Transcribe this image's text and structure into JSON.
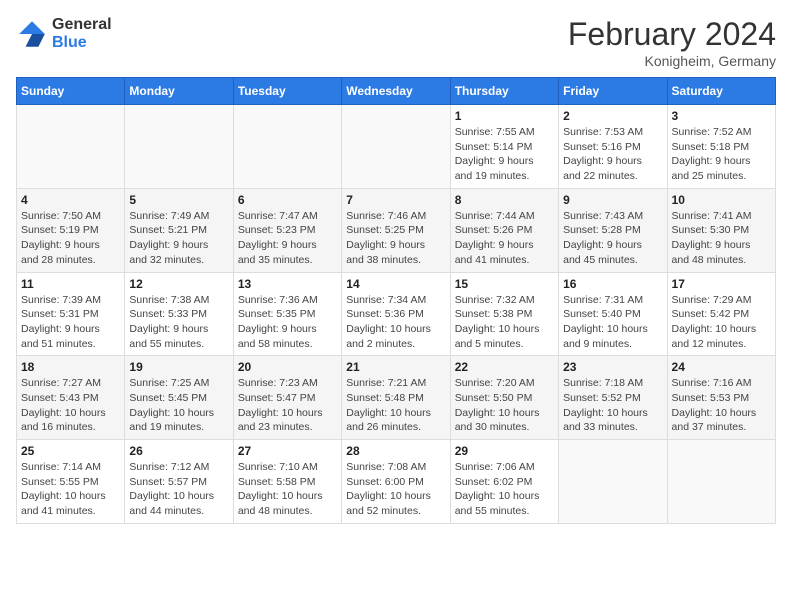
{
  "header": {
    "logo_line1": "General",
    "logo_line2": "Blue",
    "title": "February 2024",
    "subtitle": "Konigheim, Germany"
  },
  "weekdays": [
    "Sunday",
    "Monday",
    "Tuesday",
    "Wednesday",
    "Thursday",
    "Friday",
    "Saturday"
  ],
  "weeks": [
    [
      {
        "day": "",
        "info": ""
      },
      {
        "day": "",
        "info": ""
      },
      {
        "day": "",
        "info": ""
      },
      {
        "day": "",
        "info": ""
      },
      {
        "day": "1",
        "info": "Sunrise: 7:55 AM\nSunset: 5:14 PM\nDaylight: 9 hours\nand 19 minutes."
      },
      {
        "day": "2",
        "info": "Sunrise: 7:53 AM\nSunset: 5:16 PM\nDaylight: 9 hours\nand 22 minutes."
      },
      {
        "day": "3",
        "info": "Sunrise: 7:52 AM\nSunset: 5:18 PM\nDaylight: 9 hours\nand 25 minutes."
      }
    ],
    [
      {
        "day": "4",
        "info": "Sunrise: 7:50 AM\nSunset: 5:19 PM\nDaylight: 9 hours\nand 28 minutes."
      },
      {
        "day": "5",
        "info": "Sunrise: 7:49 AM\nSunset: 5:21 PM\nDaylight: 9 hours\nand 32 minutes."
      },
      {
        "day": "6",
        "info": "Sunrise: 7:47 AM\nSunset: 5:23 PM\nDaylight: 9 hours\nand 35 minutes."
      },
      {
        "day": "7",
        "info": "Sunrise: 7:46 AM\nSunset: 5:25 PM\nDaylight: 9 hours\nand 38 minutes."
      },
      {
        "day": "8",
        "info": "Sunrise: 7:44 AM\nSunset: 5:26 PM\nDaylight: 9 hours\nand 41 minutes."
      },
      {
        "day": "9",
        "info": "Sunrise: 7:43 AM\nSunset: 5:28 PM\nDaylight: 9 hours\nand 45 minutes."
      },
      {
        "day": "10",
        "info": "Sunrise: 7:41 AM\nSunset: 5:30 PM\nDaylight: 9 hours\nand 48 minutes."
      }
    ],
    [
      {
        "day": "11",
        "info": "Sunrise: 7:39 AM\nSunset: 5:31 PM\nDaylight: 9 hours\nand 51 minutes."
      },
      {
        "day": "12",
        "info": "Sunrise: 7:38 AM\nSunset: 5:33 PM\nDaylight: 9 hours\nand 55 minutes."
      },
      {
        "day": "13",
        "info": "Sunrise: 7:36 AM\nSunset: 5:35 PM\nDaylight: 9 hours\nand 58 minutes."
      },
      {
        "day": "14",
        "info": "Sunrise: 7:34 AM\nSunset: 5:36 PM\nDaylight: 10 hours\nand 2 minutes."
      },
      {
        "day": "15",
        "info": "Sunrise: 7:32 AM\nSunset: 5:38 PM\nDaylight: 10 hours\nand 5 minutes."
      },
      {
        "day": "16",
        "info": "Sunrise: 7:31 AM\nSunset: 5:40 PM\nDaylight: 10 hours\nand 9 minutes."
      },
      {
        "day": "17",
        "info": "Sunrise: 7:29 AM\nSunset: 5:42 PM\nDaylight: 10 hours\nand 12 minutes."
      }
    ],
    [
      {
        "day": "18",
        "info": "Sunrise: 7:27 AM\nSunset: 5:43 PM\nDaylight: 10 hours\nand 16 minutes."
      },
      {
        "day": "19",
        "info": "Sunrise: 7:25 AM\nSunset: 5:45 PM\nDaylight: 10 hours\nand 19 minutes."
      },
      {
        "day": "20",
        "info": "Sunrise: 7:23 AM\nSunset: 5:47 PM\nDaylight: 10 hours\nand 23 minutes."
      },
      {
        "day": "21",
        "info": "Sunrise: 7:21 AM\nSunset: 5:48 PM\nDaylight: 10 hours\nand 26 minutes."
      },
      {
        "day": "22",
        "info": "Sunrise: 7:20 AM\nSunset: 5:50 PM\nDaylight: 10 hours\nand 30 minutes."
      },
      {
        "day": "23",
        "info": "Sunrise: 7:18 AM\nSunset: 5:52 PM\nDaylight: 10 hours\nand 33 minutes."
      },
      {
        "day": "24",
        "info": "Sunrise: 7:16 AM\nSunset: 5:53 PM\nDaylight: 10 hours\nand 37 minutes."
      }
    ],
    [
      {
        "day": "25",
        "info": "Sunrise: 7:14 AM\nSunset: 5:55 PM\nDaylight: 10 hours\nand 41 minutes."
      },
      {
        "day": "26",
        "info": "Sunrise: 7:12 AM\nSunset: 5:57 PM\nDaylight: 10 hours\nand 44 minutes."
      },
      {
        "day": "27",
        "info": "Sunrise: 7:10 AM\nSunset: 5:58 PM\nDaylight: 10 hours\nand 48 minutes."
      },
      {
        "day": "28",
        "info": "Sunrise: 7:08 AM\nSunset: 6:00 PM\nDaylight: 10 hours\nand 52 minutes."
      },
      {
        "day": "29",
        "info": "Sunrise: 7:06 AM\nSunset: 6:02 PM\nDaylight: 10 hours\nand 55 minutes."
      },
      {
        "day": "",
        "info": ""
      },
      {
        "day": "",
        "info": ""
      }
    ]
  ]
}
